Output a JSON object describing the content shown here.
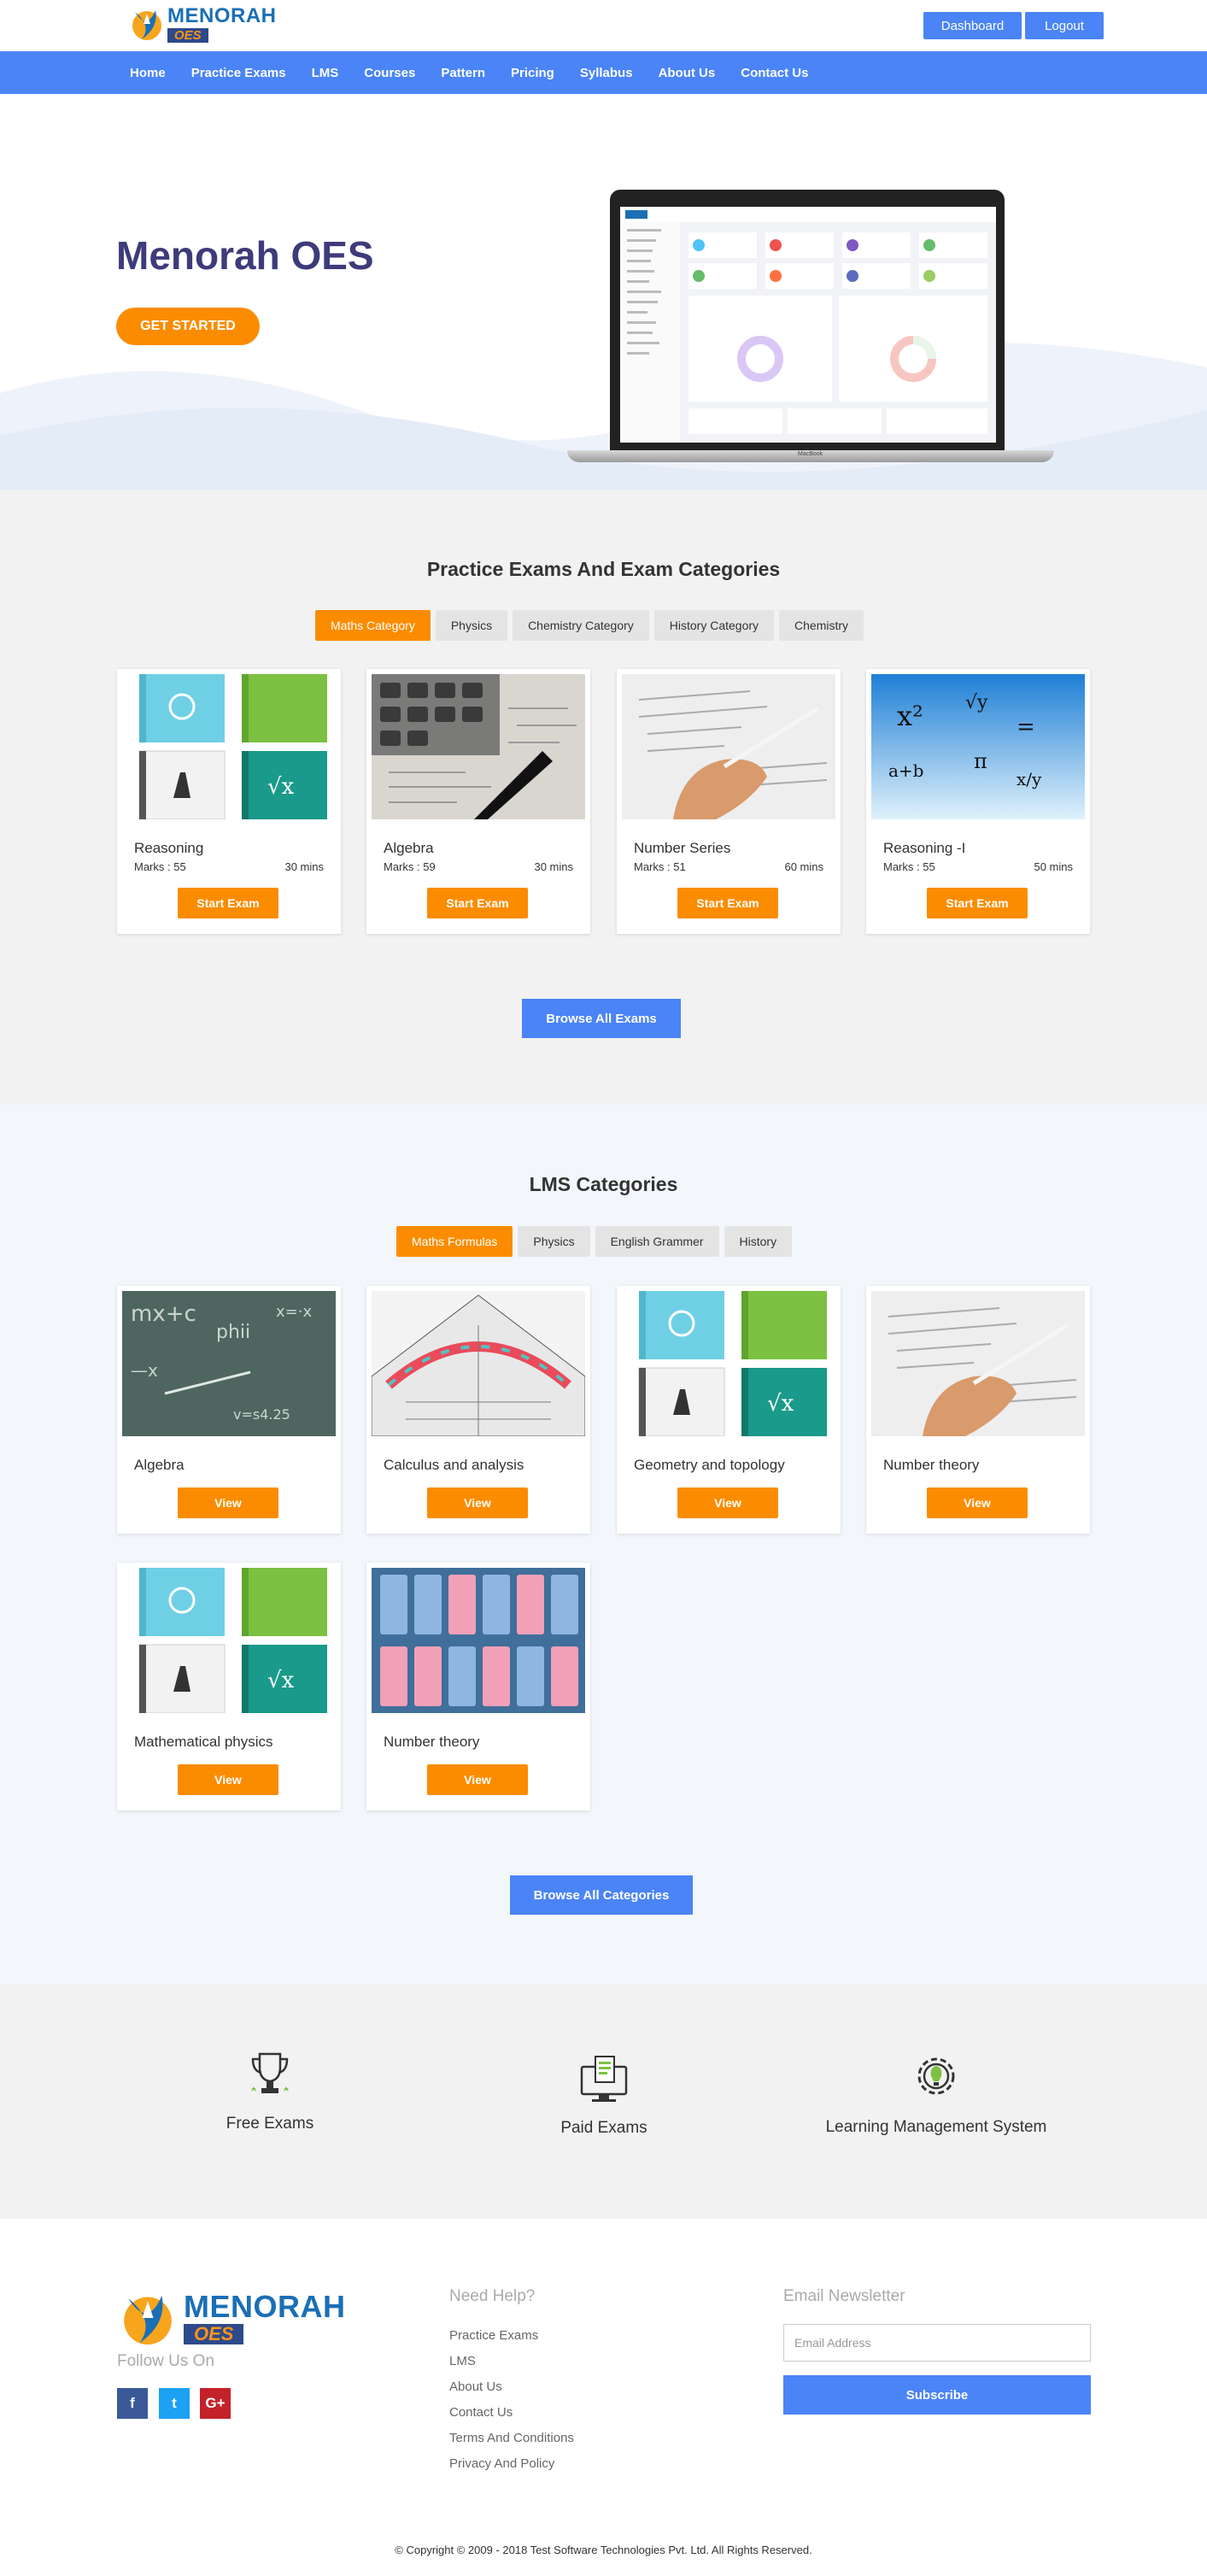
{
  "brand": {
    "name": "MENORAH",
    "tag": "OES"
  },
  "header": {
    "dashboard_label": "Dashboard",
    "logout_label": "Logout"
  },
  "nav": [
    "Home",
    "Practice Exams",
    "LMS",
    "Courses",
    "Pattern",
    "Pricing",
    "Syllabus",
    "About Us",
    "Contact Us"
  ],
  "hero": {
    "title": "Menorah OES",
    "cta": "GET STARTED",
    "laptop_brand": "MacBook"
  },
  "practice": {
    "title": "Practice Exams And Exam Categories",
    "tabs": [
      "Maths Category",
      "Physics",
      "Chemistry Category",
      "History Category",
      "Chemistry"
    ],
    "active_tab": "Maths Category",
    "exams": [
      {
        "title": "Reasoning",
        "marks": "Marks : 55",
        "duration": "30 mins",
        "button": "Start Exam",
        "image": "books-collage-icon"
      },
      {
        "title": "Algebra",
        "marks": "Marks : 59",
        "duration": "30 mins",
        "button": "Start Exam",
        "image": "calculator-photo"
      },
      {
        "title": "Number Series",
        "marks": "Marks : 51",
        "duration": "60 mins",
        "button": "Start Exam",
        "image": "hand-writing-photo"
      },
      {
        "title": "Reasoning -I",
        "marks": "Marks : 55",
        "duration": "50 mins",
        "button": "Start Exam",
        "image": "math-formulas-photo"
      }
    ],
    "browse_label": "Browse All Exams"
  },
  "lms": {
    "title": "LMS Categories",
    "tabs": [
      "Maths Formulas",
      "Physics",
      "English Grammer",
      "History"
    ],
    "active_tab": "Maths Formulas",
    "items": [
      {
        "title": "Algebra",
        "button": "View",
        "image": "chalkboard-photo"
      },
      {
        "title": "Calculus and analysis",
        "button": "View",
        "image": "protractor-photo"
      },
      {
        "title": "Geometry and topology",
        "button": "View",
        "image": "books-collage-icon"
      },
      {
        "title": "Number theory",
        "button": "View",
        "image": "hand-writing-photo"
      },
      {
        "title": "Mathematical physics",
        "button": "View",
        "image": "books-collage-icon"
      },
      {
        "title": "Number theory",
        "button": "View",
        "image": "multiplication-tables-photo"
      }
    ],
    "browse_label": "Browse All Categories"
  },
  "features": [
    {
      "label": "Free Exams",
      "icon": "trophy-icon"
    },
    {
      "label": "Paid Exams",
      "icon": "monitor-document-icon"
    },
    {
      "label": "Learning Management System",
      "icon": "gear-bulb-icon"
    }
  ],
  "footer": {
    "follow_title": "Follow Us On",
    "social": [
      {
        "label": "f",
        "icon": "facebook-icon",
        "color": "#3b5998"
      },
      {
        "label": "t",
        "icon": "twitter-icon",
        "color": "#1da1f2"
      },
      {
        "label": "G+",
        "icon": "google-plus-icon",
        "color": "#c4222b"
      }
    ],
    "help_title": "Need Help?",
    "help_links": [
      "Practice Exams",
      "LMS",
      "About Us",
      "Contact Us",
      "Terms And Conditions",
      "Privacy And Policy"
    ],
    "newsletter_title": "Email Newsletter",
    "email_placeholder": "Email Address",
    "subscribe_label": "Subscribe",
    "copyright": "© Copyright © 2009 - 2018 Test Software Technologies Pvt. Ltd. All Rights Reserved."
  },
  "colors": {
    "primary": "#4a84f6",
    "accent": "#fb8c00",
    "title": "#3d3b7a"
  }
}
